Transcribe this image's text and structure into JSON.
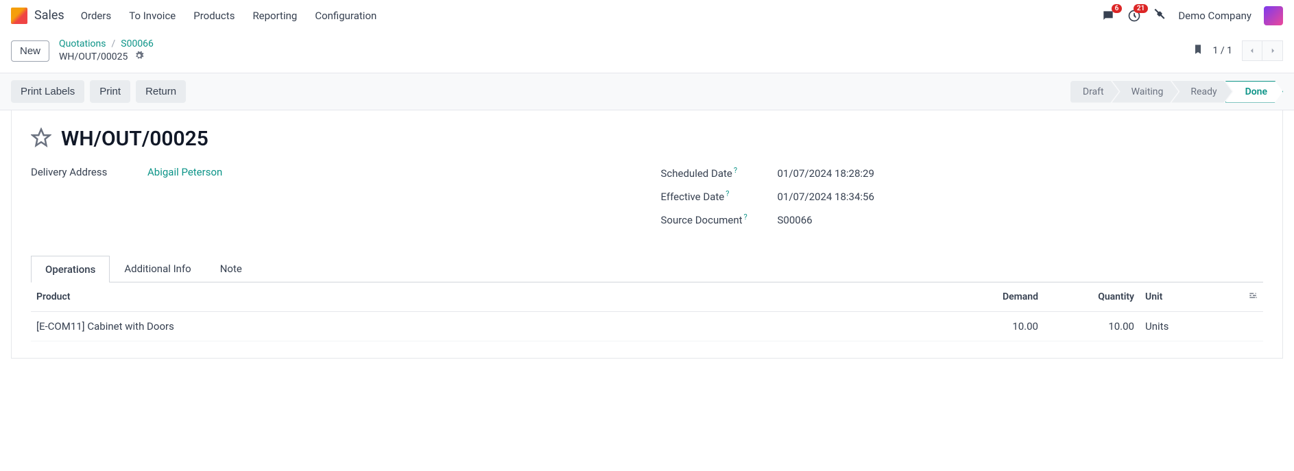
{
  "nav": {
    "app": "Sales",
    "items": [
      "Orders",
      "To Invoice",
      "Products",
      "Reporting",
      "Configuration"
    ],
    "messages_badge": "6",
    "activities_badge": "21",
    "company": "Demo Company"
  },
  "header": {
    "new_label": "New",
    "crumbs": {
      "root": "Quotations",
      "mid": "S00066",
      "current": "WH/OUT/00025"
    },
    "pager": "1 / 1"
  },
  "actions": {
    "print_labels": "Print Labels",
    "print": "Print",
    "return": "Return"
  },
  "status": {
    "steps": [
      "Draft",
      "Waiting",
      "Ready",
      "Done"
    ],
    "active": "Done"
  },
  "record": {
    "title": "WH/OUT/00025",
    "delivery_address_label": "Delivery Address",
    "delivery_address_value": "Abigail Peterson",
    "scheduled_date_label": "Scheduled Date",
    "scheduled_date_value": "01/07/2024 18:28:29",
    "effective_date_label": "Effective Date",
    "effective_date_value": "01/07/2024 18:34:56",
    "source_doc_label": "Source Document",
    "source_doc_value": "S00066"
  },
  "tabs": {
    "operations": "Operations",
    "additional": "Additional Info",
    "note": "Note"
  },
  "table": {
    "cols": {
      "product": "Product",
      "demand": "Demand",
      "quantity": "Quantity",
      "unit": "Unit"
    },
    "rows": [
      {
        "product": "[E-COM11] Cabinet with Doors",
        "demand": "10.00",
        "quantity": "10.00",
        "unit": "Units"
      }
    ]
  }
}
